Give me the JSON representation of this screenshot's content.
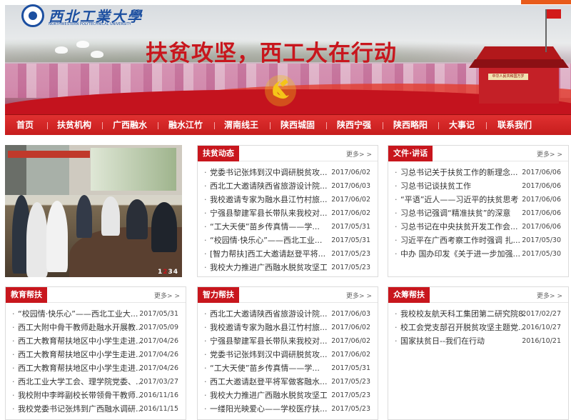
{
  "header": {
    "logo_cn": "西北工業大學",
    "logo_en": "NORTHWESTERN POLYTECHNICAL UNIVERSITY",
    "banner_title": "扶贫攻坚，西工大在行动",
    "gate_sign": "中华人民共和国万岁"
  },
  "nav": [
    "首页",
    "扶贫机构",
    "广西融水",
    "融水江竹",
    "渭南线王",
    "陕西城固",
    "陕西宁强",
    "陕西略阳",
    "大事记",
    "联系我们"
  ],
  "photo": {
    "pager": [
      "1",
      "2",
      "3",
      "4"
    ],
    "active_page": "2"
  },
  "more_label": "更多> >",
  "boxes": {
    "fupin": {
      "title": "扶贫动态",
      "items": [
        {
          "t": "党委书记张炜到汉中调研脱贫攻...",
          "d": "2017/06/02"
        },
        {
          "t": "西北工大邀请陕西省旅游设计院...",
          "d": "2017/06/03"
        },
        {
          "t": "我校邀请专家为融水县江竹村旅...",
          "d": "2017/06/02"
        },
        {
          "t": "宁强县黎建军县长带队来我校对...",
          "d": "2017/06/02"
        },
        {
          "t": "“工大天使”苗乡传真情——学...",
          "d": "2017/05/31"
        },
        {
          "t": "“校园情·快乐心”——西北工业...",
          "d": "2017/05/31"
        },
        {
          "t": "[智力帮扶]西工大邀请赵登平将...",
          "d": "2017/05/23"
        },
        {
          "t": "我校大力推进广西融水脱贫攻坚工作",
          "d": "2017/05/23"
        }
      ]
    },
    "wenjian": {
      "title": "文件·讲话",
      "items": [
        {
          "t": "习总书记关于扶贫工作的新理念...",
          "d": "2017/06/06"
        },
        {
          "t": "习总书记谈扶贫工作",
          "d": "2017/06/06"
        },
        {
          "t": "“平语”近人——习近平的扶贫思考",
          "d": "2017/06/06"
        },
        {
          "t": "习总书记强调“精准扶贫”的深意",
          "d": "2017/06/06"
        },
        {
          "t": "习总书记在中央扶贫开发工作会...",
          "d": "2017/06/06"
        },
        {
          "t": "习近平在广西考察工作时强调 扎...",
          "d": "2017/05/30"
        },
        {
          "t": "中办 国办印发《关于进一步加强...",
          "d": "2017/05/30"
        }
      ]
    },
    "jiaoyu": {
      "title": "教育帮扶",
      "items": [
        {
          "t": "“校园情·快乐心”——西北工业大...",
          "d": "2017/05/31"
        },
        {
          "t": "西工大附中骨干教师赴融水开展教...",
          "d": "2017/05/09"
        },
        {
          "t": "西工大教育帮扶地区中小学生走进...",
          "d": "2017/04/26"
        },
        {
          "t": "西工大教育帮扶地区中小学生走进...",
          "d": "2017/04/26"
        },
        {
          "t": "西工大教育帮扶地区中小学生走进...",
          "d": "2017/04/26"
        },
        {
          "t": "西北工业大学工会、理学院党委、...",
          "d": "2017/03/27"
        },
        {
          "t": "我校附中李晔副校长带领骨干教师...",
          "d": "2016/11/16"
        },
        {
          "t": "我校党委书记张炜到广西融水调研...",
          "d": "2016/11/15"
        }
      ]
    },
    "zhili": {
      "title": "智力帮扶",
      "items": [
        {
          "t": "西北工大邀请陕西省旅游设计院...",
          "d": "2017/06/03"
        },
        {
          "t": "我校邀请专家为融水县江竹村旅...",
          "d": "2017/06/02"
        },
        {
          "t": "宁强县黎建军县长带队来我校对...",
          "d": "2017/06/02"
        },
        {
          "t": "党委书记张炜到汉中调研脱贫攻...",
          "d": "2017/06/02"
        },
        {
          "t": "“工大天使”苗乡传真情——学...",
          "d": "2017/05/31"
        },
        {
          "t": "西工大邀请赵登平将军做客融水...",
          "d": "2017/05/23"
        },
        {
          "t": "我校大力推进广西融水脱贫攻坚工作",
          "d": "2017/05/23"
        },
        {
          "t": "一缕阳光映爱心——学校医疗扶...",
          "d": "2017/05/23"
        }
      ]
    },
    "zhongchou": {
      "title": "众筹帮扶",
      "items": [
        {
          "t": "我校校友航天科工集团第二研究院8...",
          "d": "2017/02/27"
        },
        {
          "t": "校工会党支部召开脱贫攻坚主题党...",
          "d": "2016/10/27"
        },
        {
          "t": "国家扶贫日--我们在行动",
          "d": "2016/10/21"
        }
      ]
    }
  },
  "colors": {
    "brand_red": "#c8161d",
    "logo_blue": "#1c4fa0"
  }
}
